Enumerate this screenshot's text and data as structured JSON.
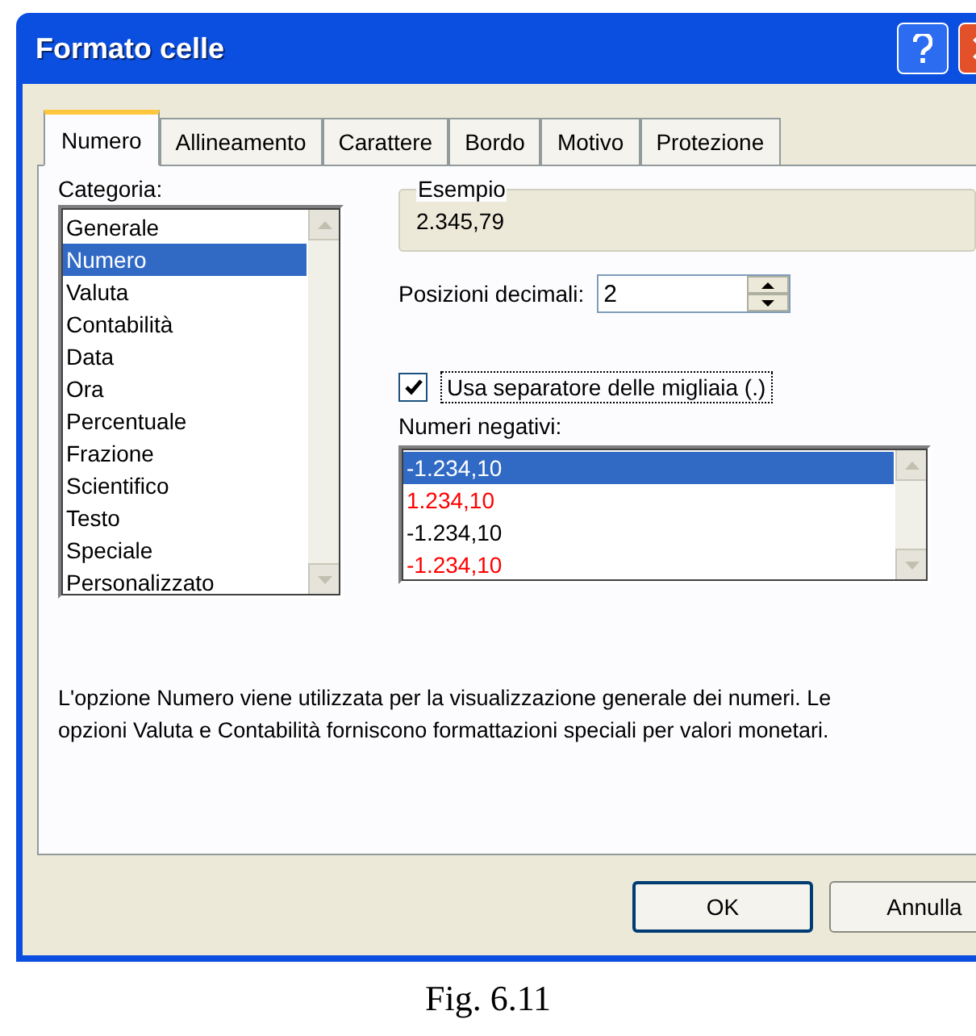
{
  "window": {
    "title": "Formato celle"
  },
  "tabs": [
    {
      "label": "Numero",
      "selected": true
    },
    {
      "label": "Allineamento",
      "selected": false
    },
    {
      "label": "Carattere",
      "selected": false
    },
    {
      "label": "Bordo",
      "selected": false
    },
    {
      "label": "Motivo",
      "selected": false
    },
    {
      "label": "Protezione",
      "selected": false
    }
  ],
  "category": {
    "label": "Categoria:",
    "items": [
      {
        "label": "Generale",
        "selected": false
      },
      {
        "label": "Numero",
        "selected": true
      },
      {
        "label": "Valuta",
        "selected": false
      },
      {
        "label": "Contabilità",
        "selected": false
      },
      {
        "label": "Data",
        "selected": false
      },
      {
        "label": "Ora",
        "selected": false
      },
      {
        "label": "Percentuale",
        "selected": false
      },
      {
        "label": "Frazione",
        "selected": false
      },
      {
        "label": "Scientifico",
        "selected": false
      },
      {
        "label": "Testo",
        "selected": false
      },
      {
        "label": "Speciale",
        "selected": false
      },
      {
        "label": "Personalizzato",
        "selected": false
      }
    ]
  },
  "sample": {
    "label": "Esempio",
    "value": "2.345,79"
  },
  "decimals": {
    "label": "Posizioni decimali:",
    "value": "2"
  },
  "thousands_separator": {
    "label": "Usa separatore delle migliaia (.)",
    "checked": true
  },
  "negative_numbers": {
    "label": "Numeri negativi:",
    "items": [
      {
        "label": "-1.234,10",
        "selected": true
      },
      {
        "label": "1.234,10",
        "color": "#ff0000",
        "selected": false
      },
      {
        "label": "-1.234,10",
        "color": "#000000",
        "selected": false
      },
      {
        "label": "-1.234,10",
        "color": "#ff0000",
        "selected": false
      }
    ]
  },
  "description": "L'opzione Numero viene utilizzata per la visualizzazione generale dei numeri. Le opzioni Valuta e Contabilità forniscono formattazioni speciali per valori monetari.",
  "buttons": [
    "OK",
    "Annulla"
  ],
  "caption": "Fig. 6.11"
}
